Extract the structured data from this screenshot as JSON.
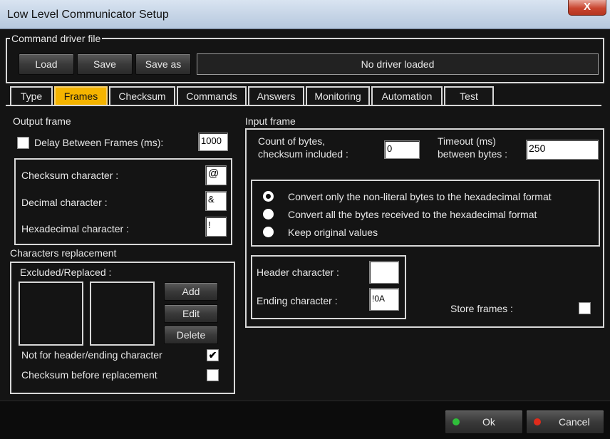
{
  "window": {
    "title": "Low Level Communicator Setup",
    "close_icon": "X"
  },
  "driver": {
    "group_title": "Command driver file",
    "load": "Load",
    "save": "Save",
    "save_as": "Save as",
    "status": "No driver loaded"
  },
  "tabs": [
    "Type",
    "Frames",
    "Checksum",
    "Commands",
    "Answers",
    "Monitoring",
    "Automation",
    "Test"
  ],
  "active_tab": "Frames",
  "output": {
    "title": "Output frame",
    "delay_label": "Delay Between Frames (ms):",
    "delay_checked": false,
    "delay_value": "1000",
    "checksum_char_label": "Checksum character  :",
    "checksum_char": "@",
    "decimal_char_label": "Decimal character  :",
    "decimal_char": "&",
    "hex_char_label": "Hexadecimal character  :",
    "hex_char": "!"
  },
  "replacement": {
    "title": "Characters replacement",
    "list_label": "Excluded/Replaced :",
    "add": "Add",
    "edit": "Edit",
    "delete": "Delete",
    "not_header_label": "Not for header/ending character",
    "not_header_checked": true,
    "checksum_before_label": "Checksum before replacement",
    "checksum_before_checked": false
  },
  "input": {
    "title": "Input frame",
    "count_label_1": "Count of bytes,",
    "count_label_2": "checksum included  :",
    "count_value": "0",
    "timeout_label_1": "Timeout (ms)",
    "timeout_label_2": "between bytes :",
    "timeout_value": "250",
    "radio_1": "Convert only the non-literal bytes to the hexadecimal format",
    "radio_2": "Convert all the bytes received to the hexadecimal format",
    "radio_3": "Keep original values",
    "radio_selected": 1,
    "header_char_label": "Header character  :",
    "header_char": "",
    "ending_char_label": "Ending character  :",
    "ending_char": "!0A",
    "store_frames_label": "Store frames :",
    "store_frames_checked": false
  },
  "footer": {
    "ok": "Ok",
    "cancel": "Cancel",
    "ok_dot_color": "#2fbf3a",
    "cancel_dot_color": "#e02b1b"
  },
  "colors": {
    "active_tab": "#f5b400",
    "background": "#141414"
  }
}
